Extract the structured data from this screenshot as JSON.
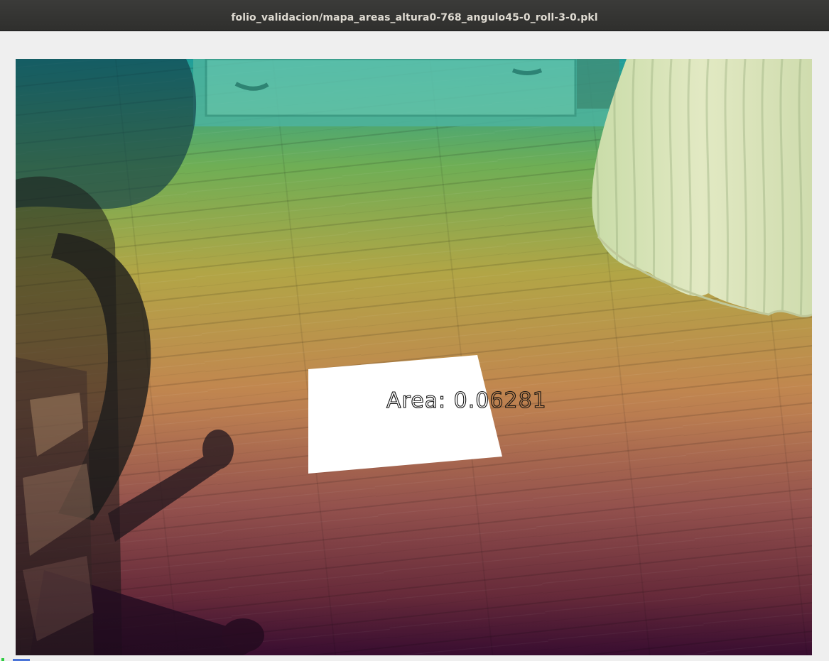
{
  "window": {
    "title": "folio_validacion/mapa_areas_altura0-768_angulo45-0_roll-3-0.pkl"
  },
  "image": {
    "area_label": "Area: 0.06281",
    "overlay_colormap": "viridis",
    "colors": {
      "top": "#2aa39a",
      "upper_mid": "#8fb03a",
      "middle": "#b8924a",
      "lower_mid": "#a0564e",
      "bottom": "#4a1240",
      "detected_region": "#ffffff"
    }
  }
}
